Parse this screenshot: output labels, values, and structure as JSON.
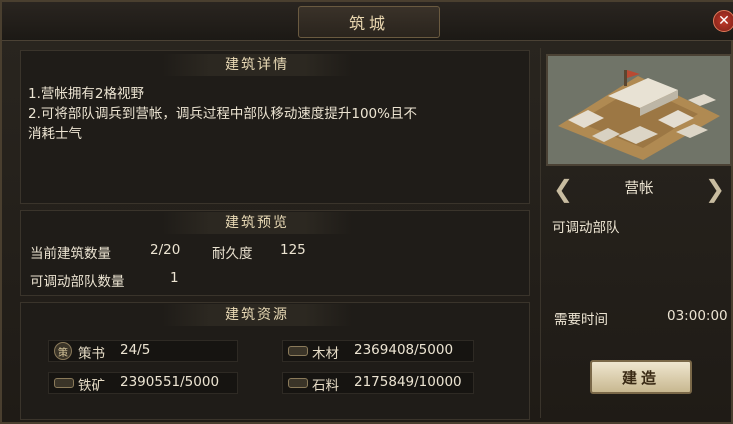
{
  "title": "筑城",
  "details": {
    "header": "建筑详情",
    "lines": [
      "1.营帐拥有2格视野",
      "2.可将部队调兵到营帐，调兵过程中部队移动速度提升100%且不",
      "消耗士气"
    ]
  },
  "preview": {
    "header": "建筑预览",
    "build_count_label": "当前建筑数量",
    "build_count_value": "2/20",
    "durability_label": "耐久度",
    "durability_value": "125",
    "army_count_label": "可调动部队数量",
    "army_count_value": "1"
  },
  "resources": {
    "header": "建筑资源",
    "items": [
      {
        "icon": "book-icon",
        "label": "策书",
        "value": "24/5"
      },
      {
        "icon": "wood-icon",
        "label": "木材",
        "value": "2369408/5000"
      },
      {
        "icon": "iron-icon",
        "label": "铁矿",
        "value": "2390551/5000"
      },
      {
        "icon": "stone-icon",
        "label": "石料",
        "value": "2175849/10000"
      }
    ]
  },
  "building": {
    "name": "营帐",
    "description": "可调动部队",
    "time_label": "需要时间",
    "time_value": "03:00:00",
    "build_button": "建造"
  }
}
